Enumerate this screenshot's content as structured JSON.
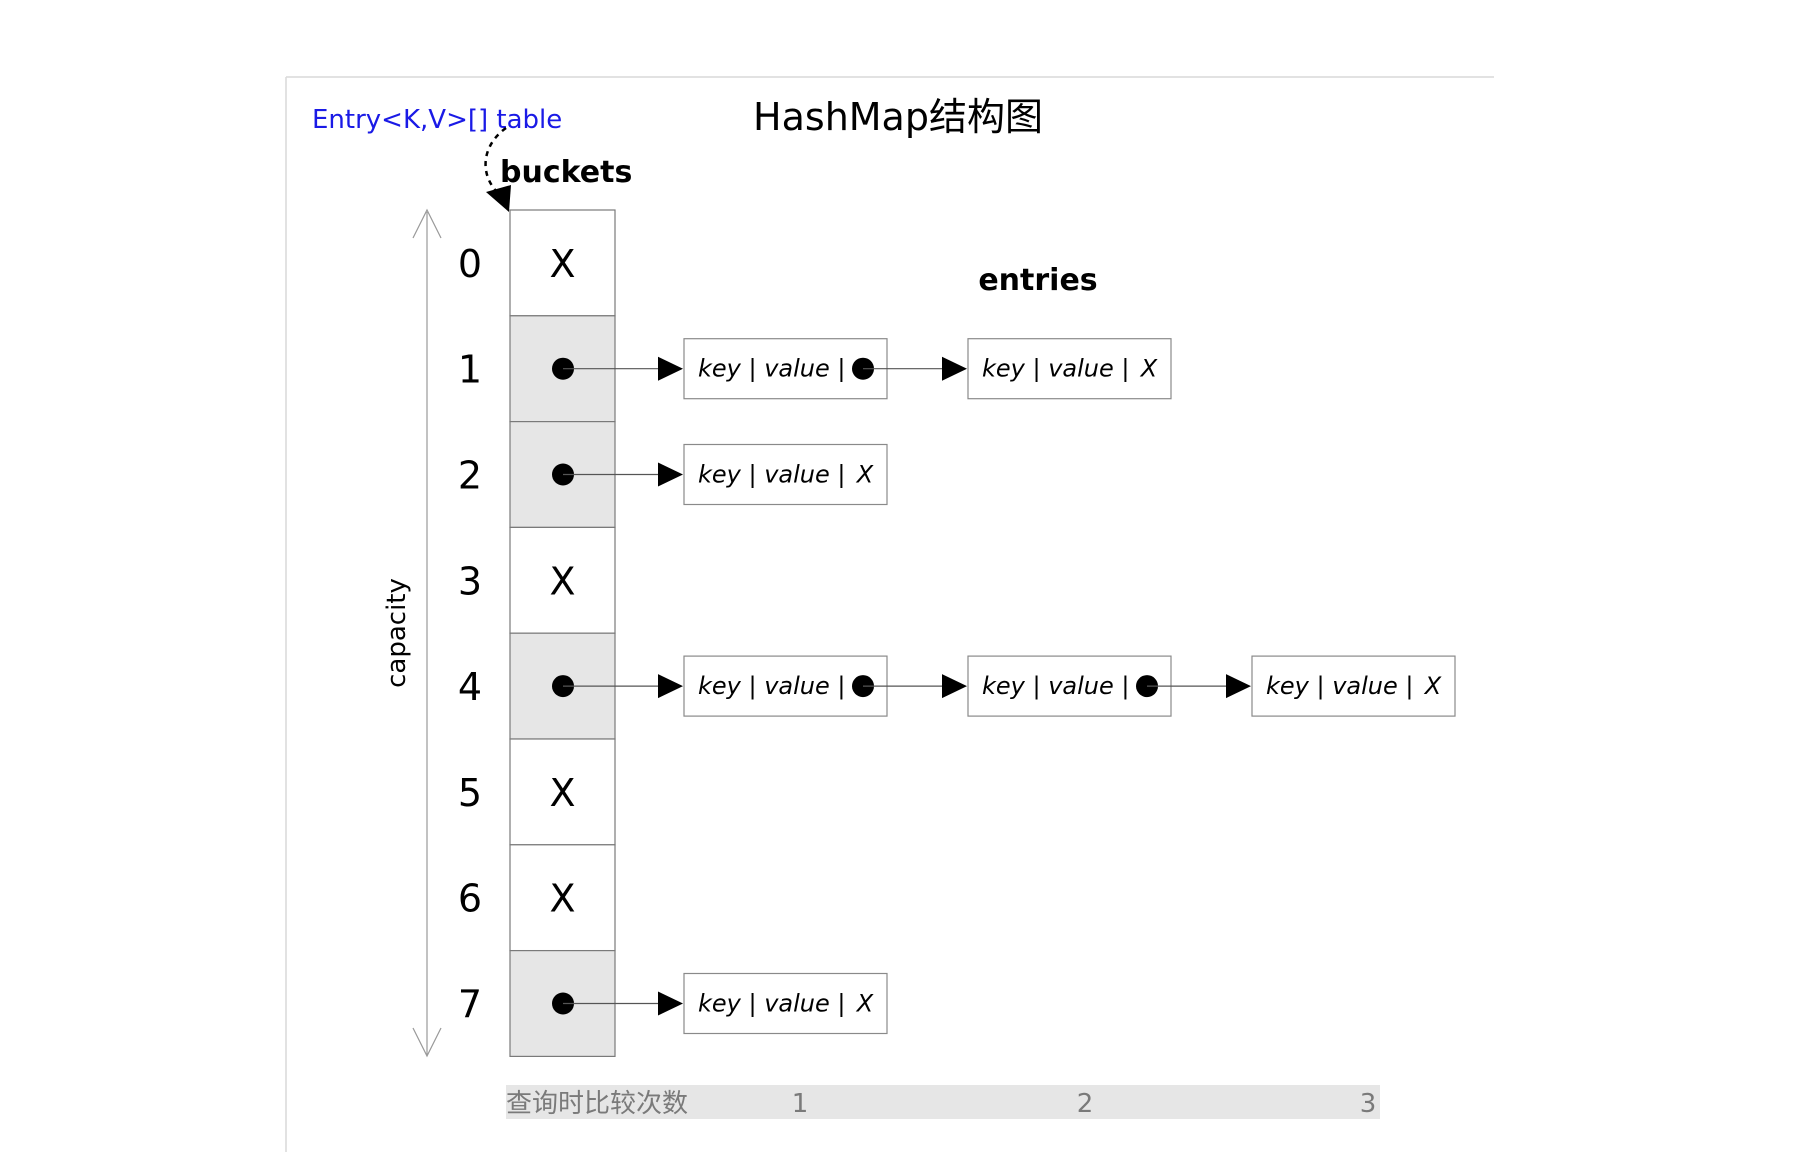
{
  "title": "HashMap结构图",
  "table_label": "Entry<K,V>[] table",
  "buckets_label": "buckets",
  "entries_label": "entries",
  "capacity_label": "capacity",
  "entry_text": "key | value |",
  "null_marker": "X",
  "buckets": [
    {
      "index": "0",
      "chain": 0
    },
    {
      "index": "1",
      "chain": 2
    },
    {
      "index": "2",
      "chain": 1
    },
    {
      "index": "3",
      "chain": 0
    },
    {
      "index": "4",
      "chain": 3
    },
    {
      "index": "5",
      "chain": 0
    },
    {
      "index": "6",
      "chain": 0
    },
    {
      "index": "7",
      "chain": 1
    }
  ],
  "comparison_scale": {
    "label": "查询时比较次数",
    "ticks": [
      "1",
      "2",
      "3"
    ]
  },
  "colors": {
    "occupied_bucket": "#e6e6e6",
    "empty_bucket": "#ffffff",
    "table_label": "#1a1ae6",
    "scale_band": "#e6e6e6"
  }
}
